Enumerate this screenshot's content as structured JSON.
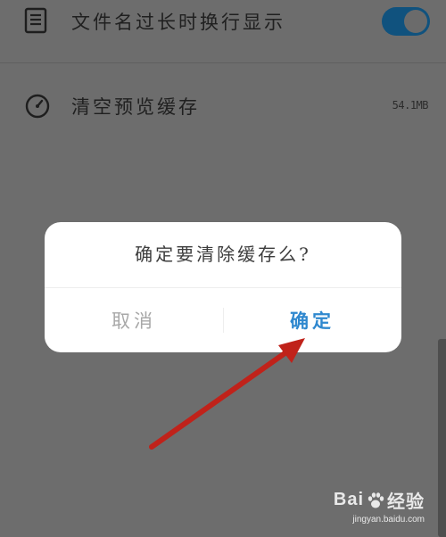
{
  "settings": {
    "wrap_filename": {
      "icon": "document-icon",
      "label": "文件名过长时换行显示",
      "toggle_on": true
    },
    "clear_cache": {
      "icon": "gauge-icon",
      "label": "清空预览缓存",
      "size": "54.1MB"
    }
  },
  "dialog": {
    "message": "确定要清除缓存么?",
    "cancel_label": "取消",
    "confirm_label": "确定"
  },
  "watermark": {
    "brand_left": "Bai",
    "brand_right": "经验",
    "url": "jingyan.baidu.com"
  },
  "colors": {
    "accent": "#2f88cf",
    "toggle_on": "#10527e",
    "annotation_arrow": "#c0221a"
  }
}
